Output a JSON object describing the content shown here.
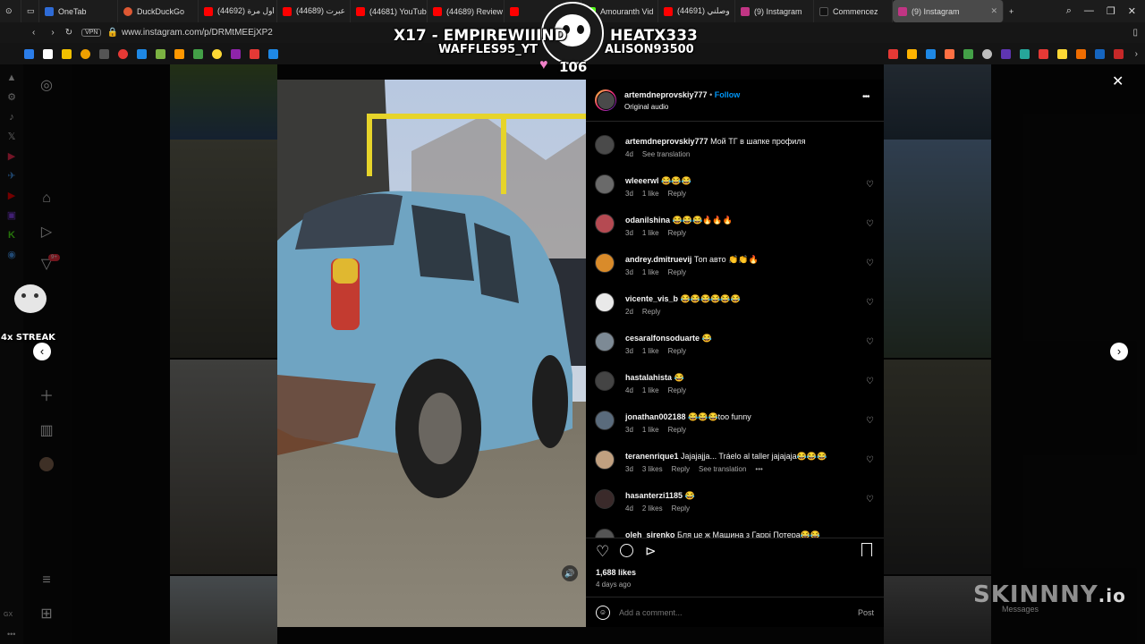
{
  "browser": {
    "tabs": [
      {
        "label": "OneTab",
        "color": "#2e6bd6"
      },
      {
        "label": "DuckDuckGo",
        "color": "#de5833"
      },
      {
        "label": "(44692) اول مرة",
        "color": "#ff0000"
      },
      {
        "label": "(44689) عبرت",
        "color": "#ff0000"
      },
      {
        "label": "(44681) YouTube",
        "color": "#ff0000"
      },
      {
        "label": "(44689) Review",
        "color": "#ff0000"
      },
      {
        "label": "(44691) وصلني",
        "color": "#ff0000"
      },
      {
        "label": "(9) Instagram",
        "color": "#c13584"
      },
      {
        "label": "Commencez",
        "color": "#111111"
      },
      {
        "label": "(9) Instagram",
        "color": "#c13584",
        "active": true
      }
    ],
    "kick_tab": "Amouranth Vid",
    "url": "www.instagram.com/p/DRMtMEEjXP2",
    "vpn": "VPN"
  },
  "post": {
    "username": "artemdneprovskiy777",
    "follow": "Follow",
    "audio": "Original audio",
    "caption_user": "artemdneprovskiy777",
    "caption_text": "Мой ТГ в шапке профиля",
    "caption_age": "4d",
    "caption_translate": "See translation",
    "likes": "1,688 likes",
    "posted": "4 days ago",
    "add_comment_placeholder": "Add a comment...",
    "post_button": "Post",
    "more": "•••"
  },
  "comments": [
    {
      "user": "wleeerwl",
      "text": "😂😂😂",
      "age": "3d",
      "likes": "1 like",
      "reply": "Reply",
      "avatar": "#6a6a6a"
    },
    {
      "user": "odanilshina",
      "text": "😂😂😂🔥🔥🔥",
      "age": "3d",
      "likes": "1 like",
      "reply": "Reply",
      "avatar": "#b54a52"
    },
    {
      "user": "andrey.dmitruevij",
      "text": "Топ авто 👏👏🔥",
      "age": "3d",
      "likes": "1 like",
      "reply": "Reply",
      "avatar": "#d98b2a"
    },
    {
      "user": "vicente_vis_b",
      "text": "😂😂😂😂😂😂",
      "age": "2d",
      "likes": "",
      "reply": "Reply",
      "avatar": "#e9e9e9"
    },
    {
      "user": "cesaralfonsoduarte",
      "text": "😂",
      "age": "3d",
      "likes": "1 like",
      "reply": "Reply",
      "avatar": "#7d8a95"
    },
    {
      "user": "hastalahista",
      "text": "😂",
      "age": "4d",
      "likes": "1 like",
      "reply": "Reply",
      "avatar": "#444444"
    },
    {
      "user": "jonathan002188",
      "text": "😂😂😂too funny",
      "age": "3d",
      "likes": "1 like",
      "reply": "Reply",
      "avatar": "#5a6b7c"
    },
    {
      "user": "teranenrique1",
      "text": "Jajajajja... Tráelo al taller jajajaja😂😂😂",
      "age": "3d",
      "likes": "3 likes",
      "reply": "Reply",
      "translate": "See translation",
      "avatar": "#c0a080"
    },
    {
      "user": "hasanterzi1185",
      "text": "😂",
      "age": "4d",
      "likes": "2 likes",
      "reply": "Reply",
      "avatar": "#3a2a2a"
    },
    {
      "user": "oleh_sirenko",
      "text": "Бля це ж Машина з Гаррі Потера😂😂",
      "age": "",
      "likes": "",
      "reply": "",
      "avatar": "#555555"
    }
  ],
  "stream_overlay": {
    "line1_left": "X17 - EMPIREWIIIND",
    "line1_right": "HEATX333",
    "line2_left": "WAFFLES95_YT",
    "line2_right": "ALISON93500",
    "hearts": "106",
    "streak": "4x STREAK",
    "watermark_brand": "SKINNNY",
    "watermark_tld": ".io",
    "messages_label": "Messages",
    "sidebar_badge": "9+"
  },
  "colors": {
    "accent": "#0095f6",
    "panel_bg": "#000000",
    "overlay_text": "#ffffff",
    "overlay_heart": "#f080c8"
  }
}
